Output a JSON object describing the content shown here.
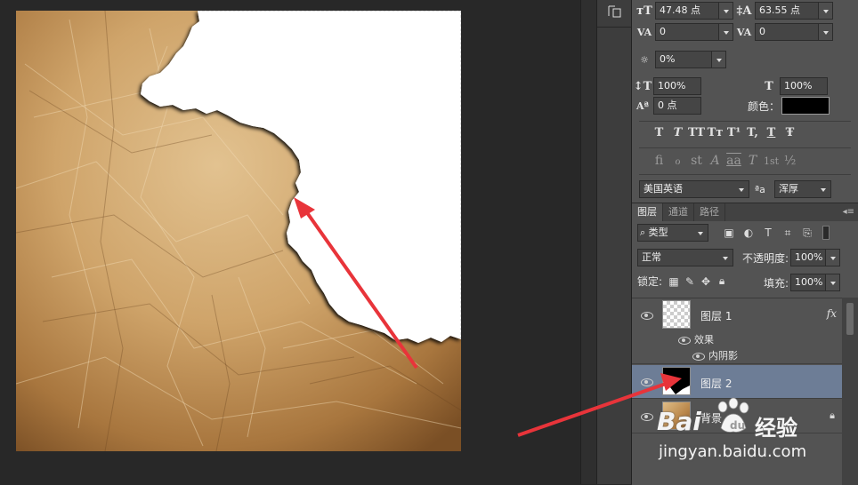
{
  "character": {
    "font_size": "47.48 点",
    "leading": "63.55 点",
    "kerning": "0",
    "tracking": "0",
    "proportional_spacing": "0%",
    "vertical_scale": "100%",
    "horizontal_scale": "100%",
    "baseline_shift": "0 点",
    "color_label": "颜色：",
    "color_value": "#000000",
    "language": "美国英语",
    "anti_alias_icon": "ªa",
    "anti_alias": "浑厚",
    "style_buttons": [
      "T",
      "T",
      "TT",
      "Tт",
      "T¹",
      "T,",
      "T",
      "Ŧ"
    ],
    "opentype_buttons": [
      "fi",
      "ℴ",
      "st",
      "A",
      "aa",
      "T",
      "1st",
      "½"
    ]
  },
  "layers_panel": {
    "tabs": [
      "图层",
      "通道",
      "路径"
    ],
    "filter_kind": "类型",
    "blend_mode": "正常",
    "opacity_label": "不透明度:",
    "opacity": "100%",
    "lock_label": "锁定:",
    "fill_label": "填充:",
    "fill": "100%",
    "layers": [
      {
        "name": "图层 1",
        "fx": "fx",
        "effects_label": "效果",
        "effects": [
          "内阴影"
        ]
      },
      {
        "name": "图层 2",
        "selected": true
      },
      {
        "name": "背景",
        "locked": true
      }
    ]
  },
  "watermark": {
    "brand_left": "Bai",
    "brand_right": "经验",
    "url": "jingyan.baidu.com"
  },
  "colors": {
    "selection_highlight": "#6d7d96",
    "arrow": "#e8343a",
    "paper": "#c8a06a"
  }
}
